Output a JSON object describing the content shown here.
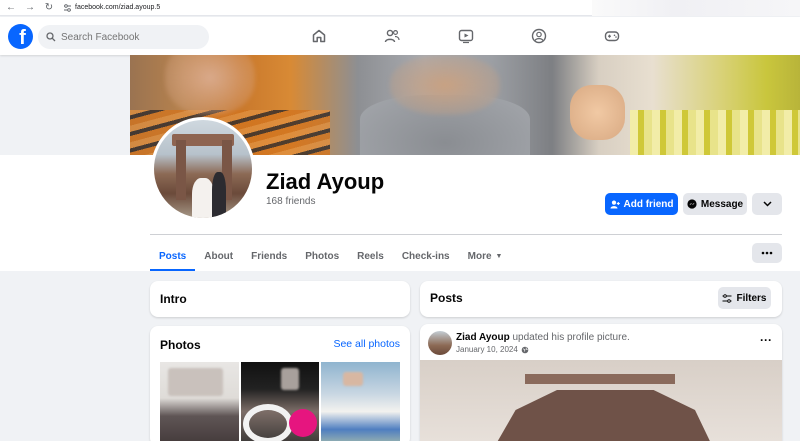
{
  "browser": {
    "url": "facebook.com/ziad.ayoup.5"
  },
  "nav": {
    "search_placeholder": "Search Facebook",
    "icons": [
      "home-icon",
      "friends-icon",
      "video-icon",
      "groups-icon",
      "gaming-icon"
    ]
  },
  "profile": {
    "name": "Ziad Ayoup",
    "friend_count": "168 friends",
    "add_friend_label": "Add friend",
    "message_label": "Message"
  },
  "tabs": [
    {
      "label": "Posts",
      "active": true
    },
    {
      "label": "About"
    },
    {
      "label": "Friends"
    },
    {
      "label": "Photos"
    },
    {
      "label": "Reels"
    },
    {
      "label": "Check-ins"
    },
    {
      "label": "More"
    }
  ],
  "intro": {
    "title": "Intro"
  },
  "photos": {
    "title": "Photos",
    "see_all": "See all photos"
  },
  "posts": {
    "title": "Posts",
    "filters_label": "Filters"
  },
  "post": {
    "author": "Ziad Ayoup",
    "action": "updated his profile picture.",
    "date": "January 10, 2024"
  },
  "colors": {
    "brand": "#0866ff",
    "background": "#f0f2f5",
    "secondary_button": "#e4e6eb"
  }
}
